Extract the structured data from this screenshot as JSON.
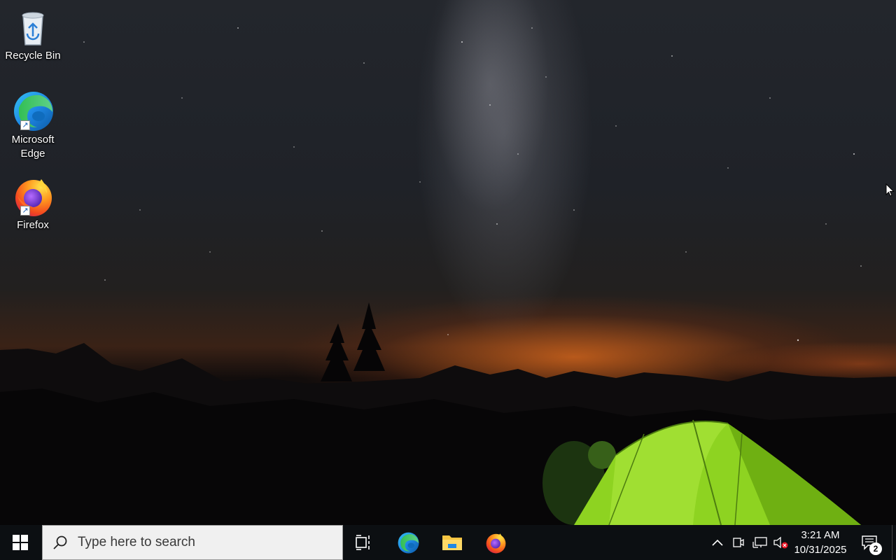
{
  "desktop": {
    "icons": [
      {
        "label": "Recycle Bin",
        "icon": "recycle-bin-icon"
      },
      {
        "label": "Microsoft Edge",
        "label_line1": "Microsoft",
        "label_line2": "Edge",
        "icon": "edge-icon"
      },
      {
        "label": "Firefox",
        "icon": "firefox-icon"
      }
    ]
  },
  "taskbar": {
    "start_icon": "windows-logo-icon",
    "search": {
      "placeholder": "Type here to search",
      "icon": "search-icon"
    },
    "pinned": [
      {
        "name": "Task View",
        "icon": "task-view-icon"
      },
      {
        "name": "Microsoft Edge",
        "icon": "edge-icon"
      },
      {
        "name": "File Explorer",
        "icon": "folder-icon"
      },
      {
        "name": "Firefox",
        "icon": "firefox-icon"
      }
    ],
    "tray": {
      "icons": [
        "chevron-up-icon",
        "meet-now-icon",
        "network-icon",
        "volume-muted-icon"
      ],
      "time": "3:21 AM",
      "date": "10/31/2025",
      "notification_count": "2"
    }
  },
  "colors": {
    "taskbar_bg": "#0c0f12",
    "search_bg": "#f0f0f0",
    "tent_green": "#8ed321",
    "horizon_orange": "#e66e1e"
  }
}
